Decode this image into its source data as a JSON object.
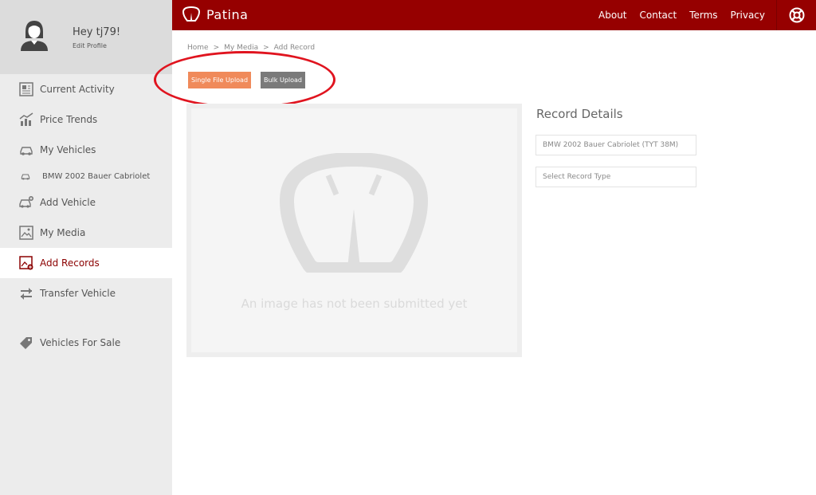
{
  "user": {
    "greeting": "Hey tj79!",
    "edit_profile": "Edit Profile"
  },
  "sidebar": {
    "items": [
      {
        "label": "Current Activity",
        "icon": "newspaper-icon"
      },
      {
        "label": "Price Trends",
        "icon": "chart-icon"
      },
      {
        "label": "My Vehicles",
        "icon": "car-icon"
      },
      {
        "label": "BMW 2002 Bauer Cabriolet",
        "icon": "car-small-icon"
      },
      {
        "label": "Add Vehicle",
        "icon": "car-plus-icon"
      },
      {
        "label": "My Media",
        "icon": "image-icon"
      },
      {
        "label": "Add Records",
        "icon": "image-plus-icon"
      },
      {
        "label": "Transfer Vehicle",
        "icon": "transfer-icon"
      },
      {
        "label": "Vehicles For Sale",
        "icon": "tag-icon"
      }
    ],
    "active": "Add Records"
  },
  "header": {
    "brand": "Patina",
    "nav": [
      "About",
      "Contact",
      "Terms",
      "Privacy"
    ],
    "help_icon": "lifebuoy-icon"
  },
  "breadcrumb": [
    "Home",
    ">",
    "My Media",
    ">",
    "Add Record"
  ],
  "upload": {
    "single_label": "Single File Upload",
    "bulk_label": "Bulk Upload"
  },
  "image_panel": {
    "placeholder_text": "An image has not been submitted yet"
  },
  "details": {
    "title": "Record Details",
    "vehicle_value": "BMW 2002 Bauer Cabriolet (TYT 38M)",
    "record_type_placeholder": "Select Record Type"
  },
  "colors": {
    "brand": "#960000",
    "single_button": "#f08a5a",
    "bulk_button": "#7a7a7a",
    "annotation": "#e0141f"
  }
}
